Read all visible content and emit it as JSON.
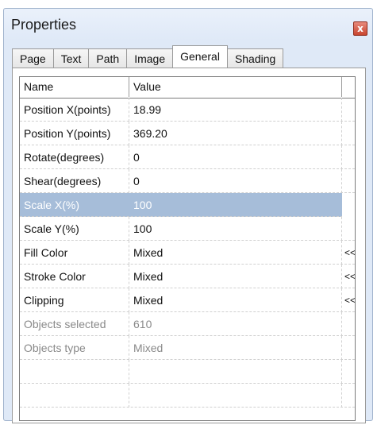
{
  "window": {
    "title": "Properties",
    "close_glyph": "x"
  },
  "tabs": [
    {
      "label": "Page",
      "active": false
    },
    {
      "label": "Text",
      "active": false
    },
    {
      "label": "Path",
      "active": false
    },
    {
      "label": "Image",
      "active": false
    },
    {
      "label": "General",
      "active": true
    },
    {
      "label": "Shading",
      "active": false
    }
  ],
  "grid": {
    "columns": {
      "name": "Name",
      "value": "Value"
    },
    "rows": [
      {
        "name": "Position X(points)",
        "value": "18.99",
        "action": ""
      },
      {
        "name": "Position Y(points)",
        "value": "369.20",
        "action": ""
      },
      {
        "name": "Rotate(degrees)",
        "value": "0",
        "action": ""
      },
      {
        "name": "Shear(degrees)",
        "value": "0",
        "action": ""
      },
      {
        "name": "Scale X(%)",
        "value": "100",
        "action": ""
      },
      {
        "name": "Scale Y(%)",
        "value": "100",
        "action": ""
      },
      {
        "name": "Fill Color",
        "value": "Mixed",
        "action": "<<"
      },
      {
        "name": "Stroke Color",
        "value": "Mixed",
        "action": "<<"
      },
      {
        "name": "Clipping",
        "value": "Mixed",
        "action": "<<"
      },
      {
        "name": "Objects selected",
        "value": "610",
        "action": ""
      },
      {
        "name": "Objects type",
        "value": "Mixed",
        "action": ""
      }
    ]
  },
  "colors": {
    "selection": "#a6bdd9",
    "disabled_text": "#8a8a8a"
  }
}
